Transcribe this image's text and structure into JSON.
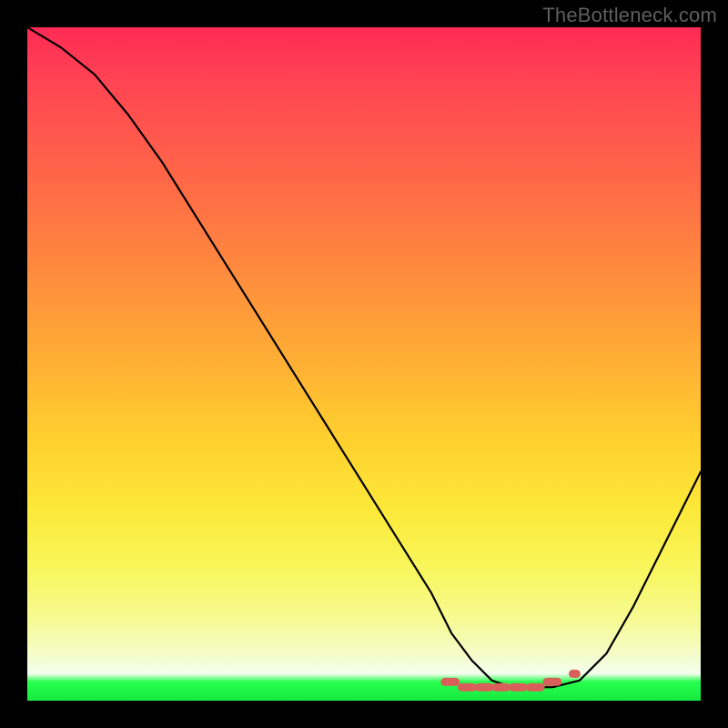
{
  "watermark": "TheBottleneck.com",
  "colors": {
    "background_black": "#000000",
    "gradient_top_red": "#ff2a55",
    "gradient_mid_orange": "#ff8a3e",
    "gradient_mid_yellow": "#fce93a",
    "gradient_bottom_green": "#16e93f",
    "curve_stroke": "#000000",
    "dash_stroke": "#d9605a",
    "watermark_gray": "#5e5e5e"
  },
  "chart_data": {
    "type": "line",
    "title": "",
    "xlabel": "",
    "ylabel": "",
    "xlim": [
      0,
      100
    ],
    "ylim": [
      0,
      100
    ],
    "description": "Bottleneck-style V curve over vertical red-to-green gradient. Minimum plateau highlighted with short salmon dashes near bottom.",
    "series": [
      {
        "name": "bottleneck-curve",
        "x": [
          0,
          5,
          10,
          15,
          20,
          25,
          30,
          35,
          40,
          45,
          50,
          55,
          60,
          63,
          66,
          69,
          72,
          75,
          78,
          82,
          86,
          90,
          94,
          98,
          100
        ],
        "y": [
          100,
          97,
          93,
          87,
          80,
          72,
          64,
          56,
          48,
          40,
          32,
          24,
          16,
          10,
          6,
          3,
          2,
          2,
          2,
          3,
          7,
          14,
          22,
          30,
          34
        ]
      }
    ],
    "highlight_dashes": {
      "x_start": 62,
      "x_end": 80,
      "y": 2,
      "segments": 7
    }
  }
}
